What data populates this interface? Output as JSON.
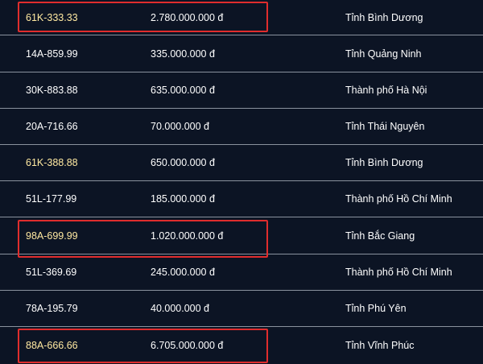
{
  "colors": {
    "background": "#0c1424",
    "text": "#ffffff",
    "highlight_plate_text": "#ffe9a1",
    "divider": "#8a929e",
    "mark_box": "#e02d2d"
  },
  "rows": [
    {
      "plate": "61K-333.33",
      "price": "2.780.000.000 đ",
      "province": "Tỉnh Bình Dương",
      "plate_highlight": true,
      "boxed": true
    },
    {
      "plate": "14A-859.99",
      "price": "335.000.000 đ",
      "province": "Tỉnh Quảng Ninh",
      "plate_highlight": false,
      "boxed": false
    },
    {
      "plate": "30K-883.88",
      "price": "635.000.000 đ",
      "province": "Thành phố Hà Nội",
      "plate_highlight": false,
      "boxed": false
    },
    {
      "plate": "20A-716.66",
      "price": "70.000.000 đ",
      "province": "Tỉnh Thái Nguyên",
      "plate_highlight": false,
      "boxed": false
    },
    {
      "plate": "61K-388.88",
      "price": "650.000.000 đ",
      "province": "Tỉnh Bình Dương",
      "plate_highlight": true,
      "boxed": false
    },
    {
      "plate": "51L-177.99",
      "price": "185.000.000 đ",
      "province": "Thành phố Hồ Chí Minh",
      "plate_highlight": false,
      "boxed": false
    },
    {
      "plate": "98A-699.99",
      "price": "1.020.000.000 đ",
      "province": "Tỉnh Bắc Giang",
      "plate_highlight": true,
      "boxed": true
    },
    {
      "plate": "51L-369.69",
      "price": "245.000.000 đ",
      "province": "Thành phố Hồ Chí Minh",
      "plate_highlight": false,
      "boxed": false
    },
    {
      "plate": "78A-195.79",
      "price": "40.000.000 đ",
      "province": "Tỉnh Phú Yên",
      "plate_highlight": false,
      "boxed": false
    },
    {
      "plate": "88A-666.66",
      "price": "6.705.000.000 đ",
      "province": "Tỉnh Vĩnh Phúc",
      "plate_highlight": true,
      "boxed": true
    }
  ]
}
